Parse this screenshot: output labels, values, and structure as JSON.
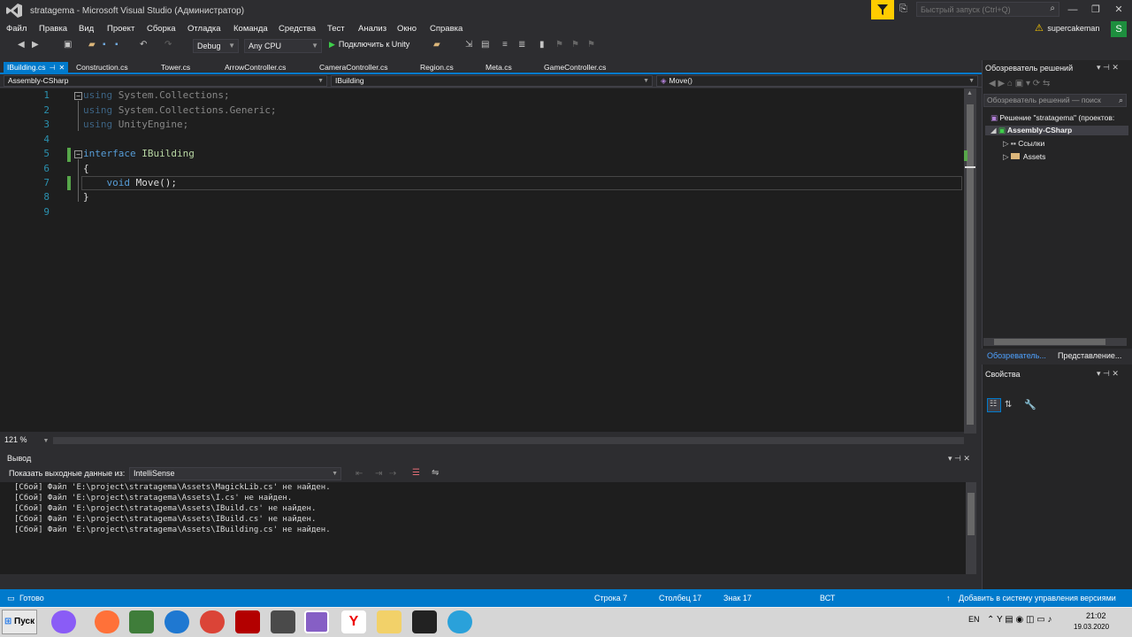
{
  "window": {
    "title": "stratagema - Microsoft Visual Studio  (Администратор)",
    "quick_launch_placeholder": "Быстрый запуск (Ctrl+Q)",
    "user": "supercakeman",
    "avatar_letter": "S"
  },
  "menu": [
    "Файл",
    "Правка",
    "Вид",
    "Проект",
    "Сборка",
    "Отладка",
    "Команда",
    "Средства",
    "Тест",
    "Анализ",
    "Окно",
    "Справка"
  ],
  "toolbar": {
    "config": "Debug",
    "platform": "Any CPU",
    "attach": "Подключить к Unity"
  },
  "tabs": [
    {
      "label": "IBuilding.cs",
      "active": true
    },
    {
      "label": "Construction.cs"
    },
    {
      "label": "Tower.cs"
    },
    {
      "label": "ArrowController.cs"
    },
    {
      "label": "CameraController.cs"
    },
    {
      "label": "Region.cs"
    },
    {
      "label": "Meta.cs"
    },
    {
      "label": "GameController.cs"
    }
  ],
  "navbar": {
    "project": "Assembly-CSharp",
    "type": "IBuilding",
    "member": "Move()"
  },
  "editor": {
    "line_numbers": [
      "1",
      "2",
      "3",
      "4",
      "5",
      "6",
      "7",
      "8",
      "9"
    ],
    "ns1": "System.Collections;",
    "ns2": "System.Collections.Generic;",
    "ns3": "UnityEngine;",
    "kw_using": "using",
    "kw_interface": "interface",
    "iface_name": "IBuilding",
    "brace_open": "{",
    "kw_void": "void",
    "method": " Move();",
    "brace_close": "}",
    "zoom": "121 %"
  },
  "output": {
    "title": "Вывод",
    "source_label": "Показать выходные данные из:",
    "source_value": "IntelliSense",
    "lines": [
      "[Сбой] Файл 'E:\\project\\stratagema\\Assets\\MagickLib.cs' не найден.",
      "[Сбой] Файл 'E:\\project\\stratagema\\Assets\\I.cs' не найден.",
      "[Сбой] Файл 'E:\\project\\stratagema\\Assets\\IBuild.cs' не найден.",
      "[Сбой] Файл 'E:\\project\\stratagema\\Assets\\IBuild.cs' не найден.",
      "[Сбой] Файл 'E:\\project\\stratagema\\Assets\\IBuilding.cs' не найден."
    ]
  },
  "solution_explorer": {
    "title": "Обозреватель решений",
    "search_placeholder": "Обозреватель решений — поиск",
    "solution": "Решение \"stratagema\" (проектов:",
    "project": "Assembly-CSharp",
    "refs": "Ссылки",
    "assets": "Assets",
    "tab1": "Обозреватель...",
    "tab2": "Представление..."
  },
  "properties": {
    "title": "Свойства"
  },
  "status": {
    "ready": "Готово",
    "line": "Строка 7",
    "col": "Столбец 17",
    "char": "Знак 17",
    "mode": "ВСТ",
    "vcs": "Добавить в систему управления версиями"
  },
  "taskbar": {
    "start": "Пуск",
    "lang": "EN",
    "time": "21:02",
    "date": "19.03.2020"
  },
  "colors": {
    "accent": "#007acc",
    "keyword": "#569cd6",
    "interface": "#b8d7a3",
    "line_number": "#2b91af"
  }
}
